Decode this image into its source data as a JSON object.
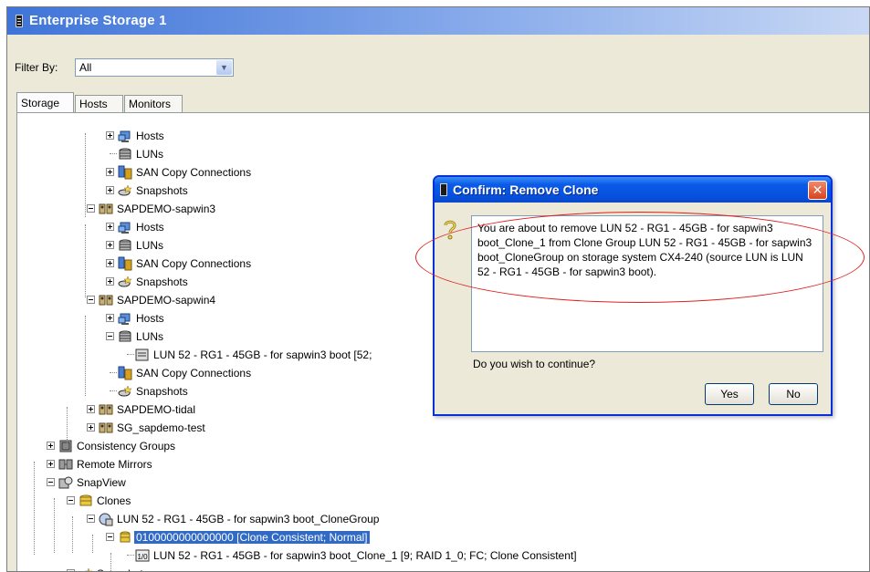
{
  "window": {
    "title": "Enterprise Storage 1"
  },
  "filter": {
    "label": "Filter By:",
    "value": "All"
  },
  "tabs": [
    {
      "label": "Storage",
      "active": true
    },
    {
      "label": "Hosts",
      "active": false
    },
    {
      "label": "Monitors",
      "active": false
    }
  ],
  "tree": {
    "rows": [
      {
        "label": "Hosts",
        "icon": "hosts-icon",
        "expander": "plus"
      },
      {
        "label": "LUNs",
        "icon": "luns-icon",
        "expander": "none"
      },
      {
        "label": "SAN Copy Connections",
        "icon": "san-copy-icon",
        "expander": "plus"
      },
      {
        "label": "Snapshots",
        "icon": "snapshots-icon",
        "expander": "plus"
      },
      {
        "label": "SAPDEMO-sapwin3",
        "icon": "storage-group-icon",
        "expander": "minus"
      },
      {
        "label": "Hosts",
        "icon": "hosts-icon",
        "expander": "plus"
      },
      {
        "label": "LUNs",
        "icon": "luns-icon",
        "expander": "plus"
      },
      {
        "label": "SAN Copy Connections",
        "icon": "san-copy-icon",
        "expander": "plus"
      },
      {
        "label": "Snapshots",
        "icon": "snapshots-icon",
        "expander": "plus"
      },
      {
        "label": "SAPDEMO-sapwin4",
        "icon": "storage-group-icon",
        "expander": "minus"
      },
      {
        "label": "Hosts",
        "icon": "hosts-icon",
        "expander": "plus"
      },
      {
        "label": "LUNs",
        "icon": "luns-icon",
        "expander": "minus"
      },
      {
        "label": "LUN 52 - RG1 - 45GB - for sapwin3 boot [52;",
        "icon": "lun-icon",
        "expander": "none"
      },
      {
        "label": "SAN Copy Connections",
        "icon": "san-copy-icon",
        "expander": "none"
      },
      {
        "label": "Snapshots",
        "icon": "snapshots-icon",
        "expander": "none"
      },
      {
        "label": "SAPDEMO-tidal",
        "icon": "storage-group-icon",
        "expander": "plus"
      },
      {
        "label": "SG_sapdemo-test",
        "icon": "storage-group-icon",
        "expander": "plus"
      },
      {
        "label": "Consistency Groups",
        "icon": "consistency-groups-icon",
        "expander": "plus"
      },
      {
        "label": "Remote Mirrors",
        "icon": "remote-mirrors-icon",
        "expander": "plus"
      },
      {
        "label": "SnapView",
        "icon": "snapview-icon",
        "expander": "minus"
      },
      {
        "label": "Clones",
        "icon": "clones-icon",
        "expander": "minus"
      },
      {
        "label": "LUN 52 - RG1 - 45GB - for sapwin3 boot_CloneGroup",
        "icon": "clone-group-icon",
        "expander": "minus"
      },
      {
        "label": "0100000000000000 [Clone Consistent; Normal]",
        "icon": "clone-icon",
        "expander": "minus",
        "selected": true
      },
      {
        "label": "LUN 52 - RG1 - 45GB - for sapwin3 boot_Clone_1 [9; RAID 1_0; FC; Clone Consistent]",
        "icon": "clone-lun-icon",
        "expander": "none",
        "badge": "1/0"
      },
      {
        "label": "Snapshots",
        "icon": "snapshots-icon",
        "expander": "plus"
      }
    ]
  },
  "dialog": {
    "title": "Confirm: Remove Clone",
    "message": "You are about to remove LUN 52 - RG1 - 45GB - for sapwin3 boot_Clone_1 from Clone Group LUN 52 - RG1 - 45GB - for sapwin3 boot_CloneGroup on storage system CX4-240 (source LUN is LUN 52 - RG1 - 45GB - for sapwin3 boot).",
    "question": "Do you wish to continue?",
    "yes_label": "Yes",
    "no_label": "No",
    "close_symbol": "✕",
    "icon": "question-icon"
  },
  "colors": {
    "selection": "#316ac5",
    "annotation": "#e02020",
    "dialog_title": "#0a5ae8"
  }
}
